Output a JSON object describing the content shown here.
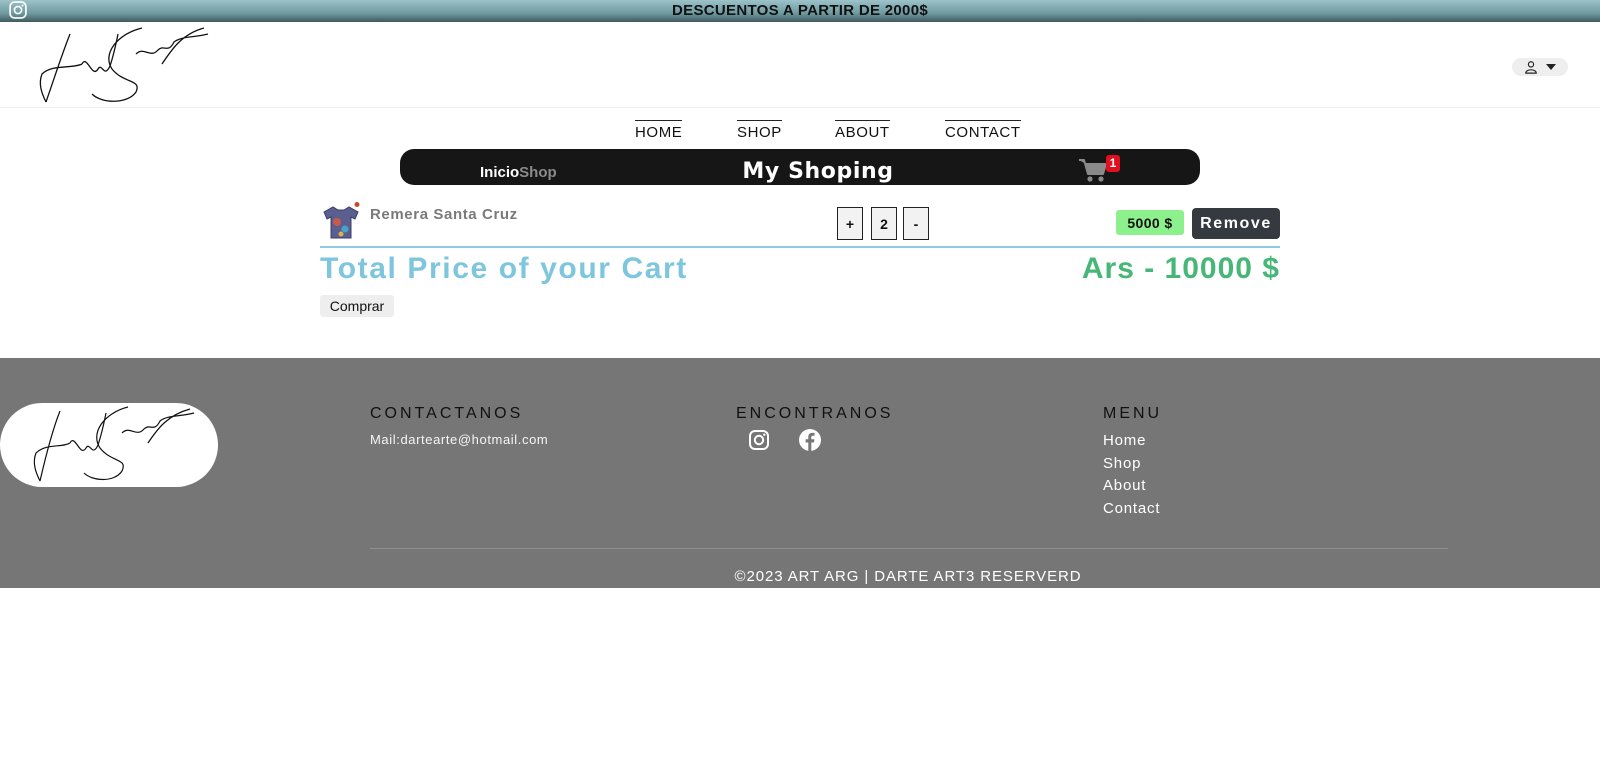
{
  "promo": {
    "text": "DESCUENTOS A PARTIR DE 2000$",
    "icon": "instagram-icon"
  },
  "header": {
    "logo": "signature-logo",
    "user_icon": "user-icon"
  },
  "nav": {
    "items": [
      "HOME",
      "SHOP",
      "ABOUT",
      "CONTACT"
    ]
  },
  "shopbar": {
    "crumb_home": "Inicio",
    "crumb_current": "Shop",
    "title": "My Shoping",
    "cart_count": "1"
  },
  "cart": {
    "items": [
      {
        "name": "Remera Santa Cruz",
        "plus": "+",
        "quantity": "2",
        "minus": "-",
        "price": "5000 $",
        "remove_label": "Remove"
      }
    ],
    "total_label": "Total Price of your Cart",
    "total_value": "Ars - 10000 $",
    "buy_label": "Comprar"
  },
  "footer": {
    "contact_title": "CONTACTANOS",
    "mail": "Mail:dartearte@hotmail.com",
    "find_title": "ENCONTRANOS",
    "menu_title": "MENU",
    "menu_items": [
      "Home",
      "Shop",
      "About",
      "Contact"
    ],
    "copyright": "©2023 ART ARG | DARTE ART3 RESERVERD"
  },
  "colors": {
    "total_label": "#7ec5de",
    "total_value": "#46b777",
    "price_tag": "#8cf08c",
    "badge": "#e0101e",
    "footer": "#767676"
  }
}
